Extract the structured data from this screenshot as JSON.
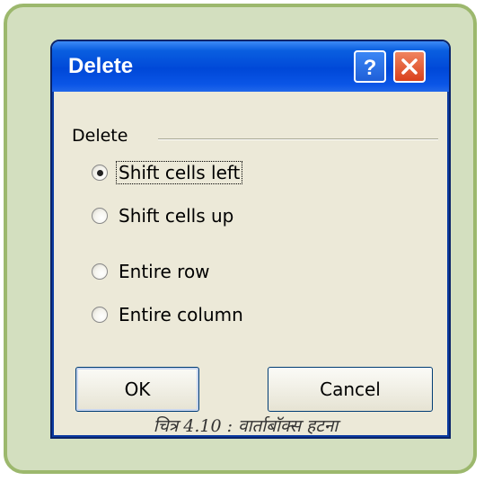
{
  "dialog": {
    "title": "Delete",
    "title_buttons": {
      "help": "?"
    },
    "group_label": "Delete",
    "options": [
      {
        "label": "Shift cells left",
        "selected": true
      },
      {
        "label": "Shift cells up",
        "selected": false
      },
      {
        "label": "Entire row",
        "selected": false
      },
      {
        "label": "Entire column",
        "selected": false
      }
    ],
    "ok_label": "OK",
    "cancel_label": "Cancel"
  },
  "caption": "चित्र 4.10 : वार्ताबॉक्स हटना",
  "colors": {
    "frame_fill": "#d3dfbf",
    "frame_border": "#9cb86d",
    "titlebar": "#0048d8",
    "dialog_bg": "#ece9d8",
    "close_button": "#d9411c"
  },
  "icons": [
    "help-icon",
    "close-icon"
  ]
}
